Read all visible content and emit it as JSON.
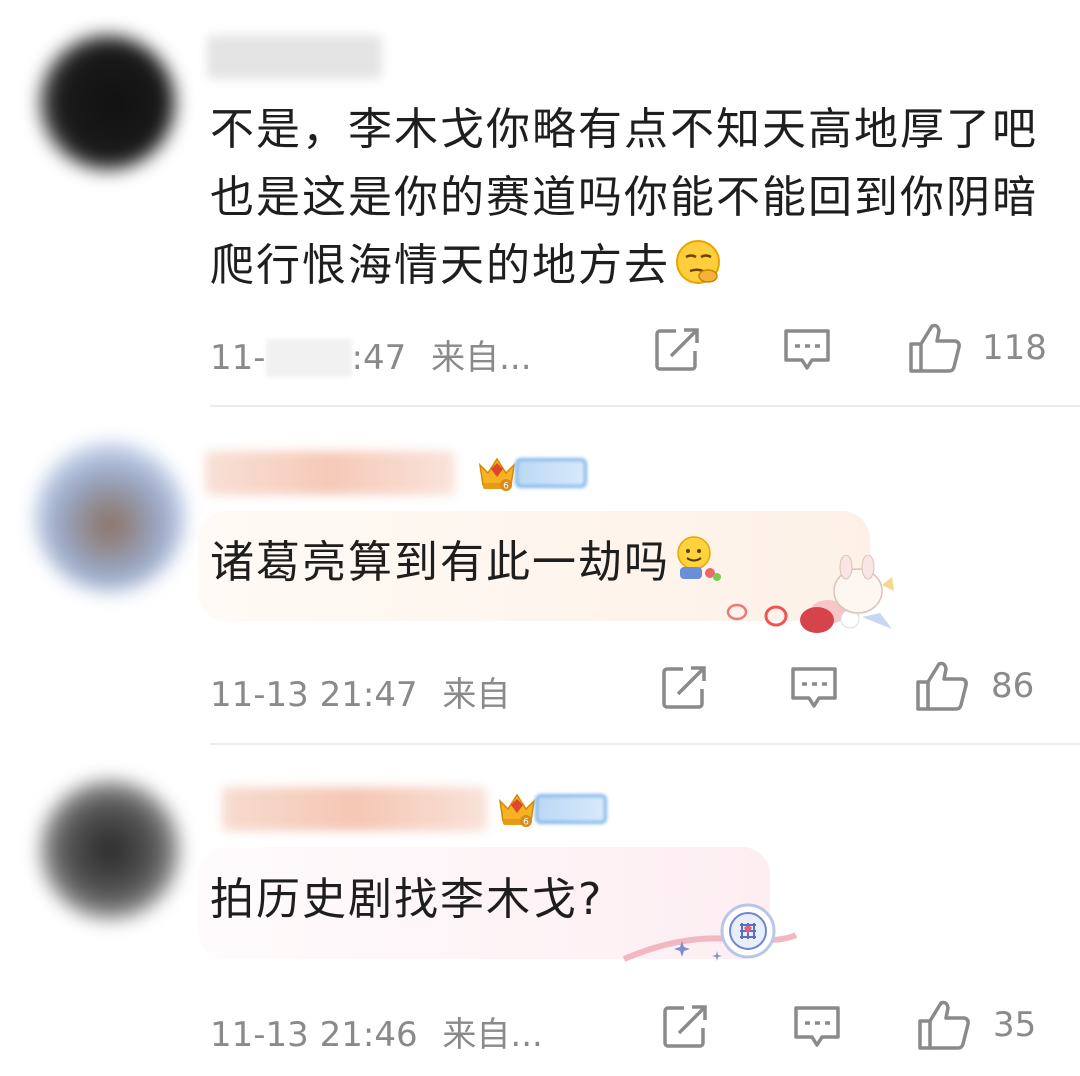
{
  "comments": [
    {
      "text": "不是，李木戈你略有点不知天高地厚了吧也是这是你的赛道吗你能不能回到你阴暗爬行恨海情天的地方去",
      "emoji": "pondering-face-emoji",
      "time": "11-",
      "time_tail": ":47",
      "source": "来自...",
      "likes": "118"
    },
    {
      "text": "诸葛亮算到有此一劫吗",
      "emoji": "smiling-face-with-hand-emoji",
      "time": "11-13 21:47",
      "source": "来自",
      "likes": "86"
    },
    {
      "text": "拍历史剧找李木戈?",
      "time": "11-13 21:46",
      "source": "来自...",
      "likes": "35"
    }
  ],
  "colors": {
    "text": "#1e1e1e",
    "meta": "#8a8a8a",
    "divider": "#ececec",
    "badge_blue": "#7fb6ec",
    "bubble_peach": "#fdf3ea",
    "bubble_pink": "#fdeff2"
  }
}
